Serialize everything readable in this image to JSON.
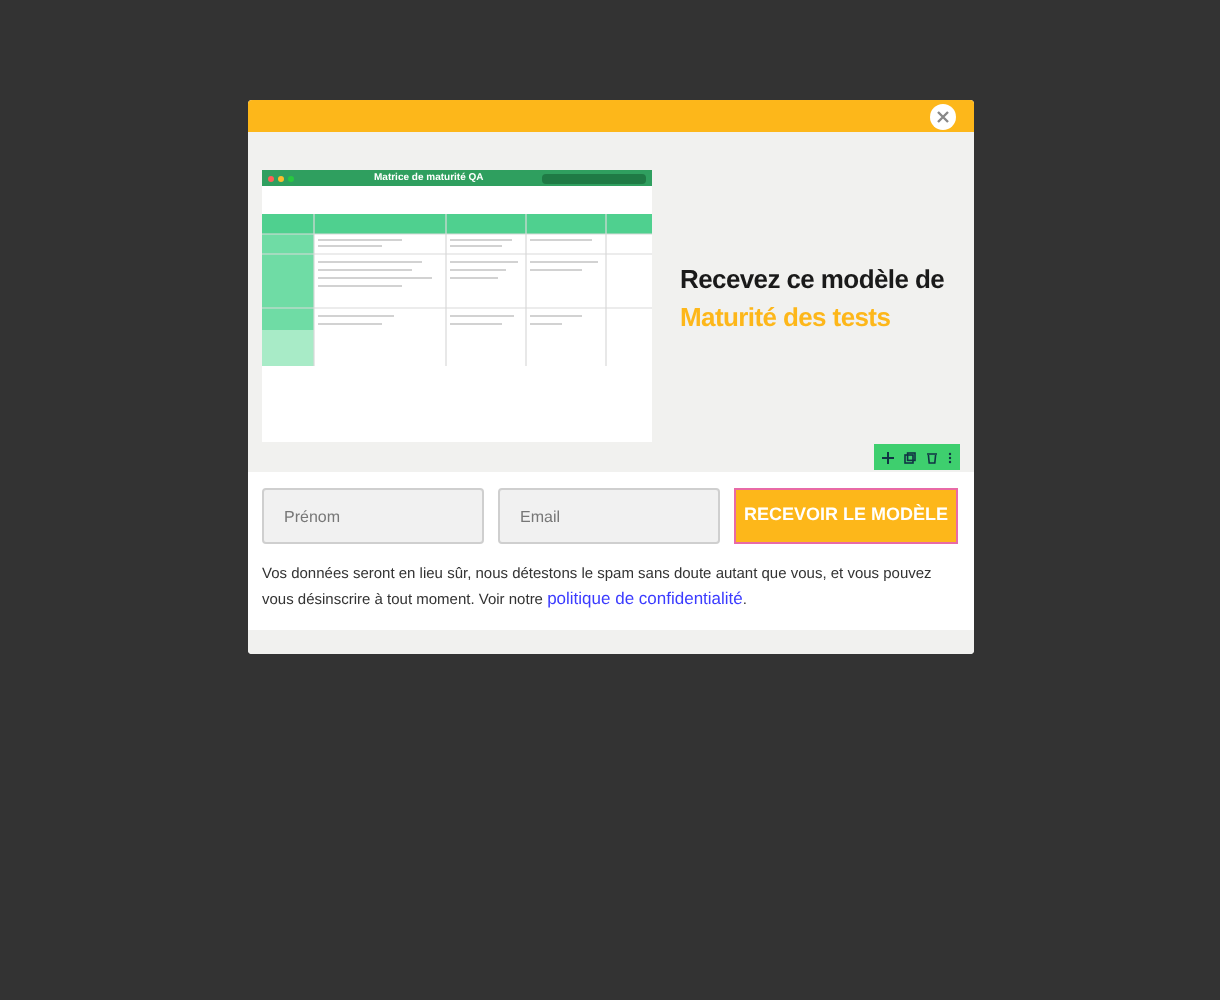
{
  "preview": {
    "window_title": "Matrice de maturité QA"
  },
  "heading": {
    "line_1": "Recevez ce modèle de",
    "line_2": "Maturité des tests"
  },
  "form": {
    "fields": [
      {
        "placeholder": "Prénom"
      },
      {
        "placeholder": "Email"
      }
    ],
    "submit": "RECEVOIR LE MODÈLE"
  },
  "notice": {
    "text": "Vos données seront en lieu sûr, nous détestons le spam sans doute autant que vous, et vous pouvez vous désinscrire à tout moment. Voir notre",
    "link": "politique de confidentialité",
    "after": "."
  }
}
